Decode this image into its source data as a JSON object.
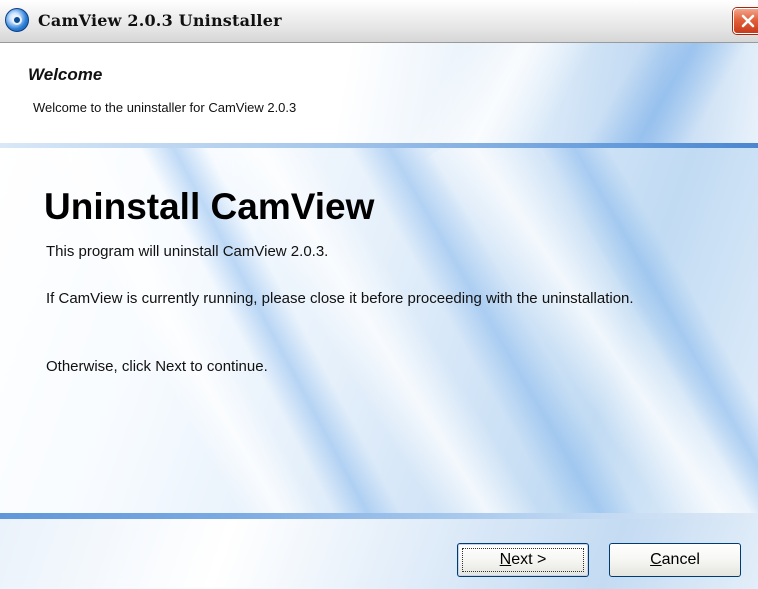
{
  "window": {
    "title": "CamView 2.0.3 Uninstaller"
  },
  "header": {
    "title": "Welcome",
    "subtitle": "Welcome to the uninstaller for CamView 2.0.3"
  },
  "main": {
    "heading": "Uninstall CamView",
    "paragraphs": [
      "This program will uninstall CamView 2.0.3.",
      "If CamView is currently running, please close it before proceeding with the uninstallation.",
      "Otherwise, click Next to continue."
    ]
  },
  "buttons": {
    "next": {
      "mnemonic": "N",
      "rest": "ext >"
    },
    "cancel": {
      "mnemonic": "C",
      "rest": "ancel"
    }
  },
  "icons": {
    "app": "camview-app-icon",
    "close": "close-icon"
  },
  "colors": {
    "close_button": "#e2613b",
    "button_border": "#003c74",
    "accent_blue": "#5f97d9"
  }
}
